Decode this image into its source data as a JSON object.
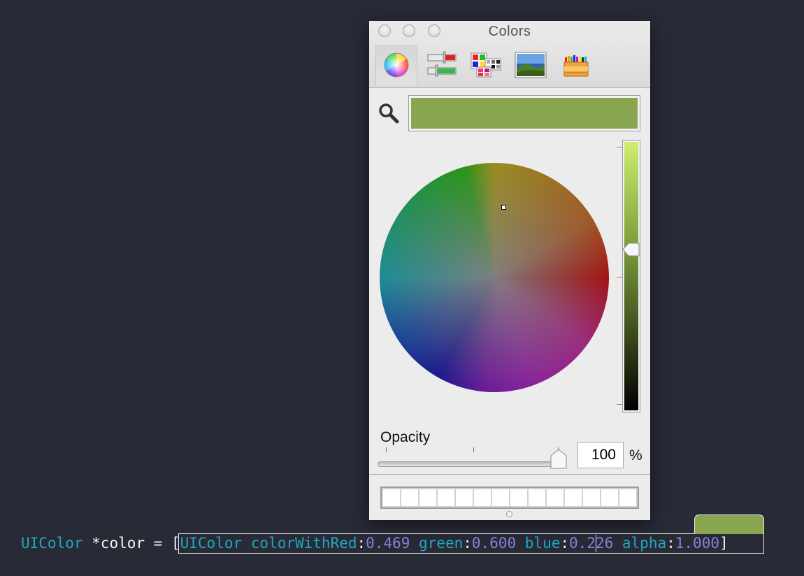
{
  "colors_panel": {
    "title": "Colors",
    "toolbar": [
      {
        "name": "color-wheel",
        "icon": "color-wheel-icon",
        "selected": true
      },
      {
        "name": "color-sliders",
        "icon": "sliders-icon",
        "selected": false
      },
      {
        "name": "color-palettes",
        "icon": "palettes-icon",
        "selected": false
      },
      {
        "name": "image-palettes",
        "icon": "image-icon",
        "selected": false
      },
      {
        "name": "crayons",
        "icon": "crayons-icon",
        "selected": false
      }
    ],
    "current_color": "#8aa54f",
    "brightness_fraction": 0.6,
    "opacity_label": "Opacity",
    "opacity_value": "100",
    "opacity_unit": "%",
    "swatch_count": 14
  },
  "code": {
    "declaration": "UIColor *color = ",
    "open_bracket": "[",
    "class_name": "UIColor",
    "method_red": "colorWithRed",
    "colon": ":",
    "red": "0.469",
    "green_label": "green",
    "green": "0.600",
    "blue_label": "blue",
    "blue": "0.226",
    "alpha_label": "alpha",
    "alpha": "1.000",
    "close_bracket": "]",
    "preview_color": "#8aa54f"
  }
}
